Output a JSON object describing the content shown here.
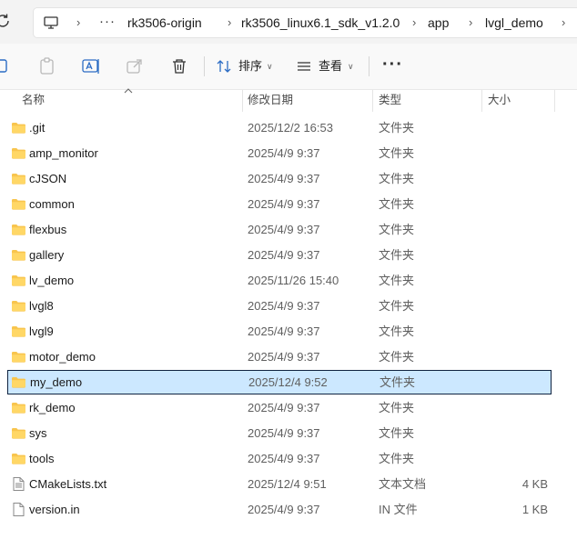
{
  "breadcrumb": {
    "overflow": "···",
    "items": [
      "rk3506-origin",
      "rk3506_linux6.1_sdk_v1.2.0",
      "app",
      "lvgl_demo"
    ]
  },
  "toolbar": {
    "sort_label": "排序",
    "view_label": "查看",
    "more_label": "···"
  },
  "columns": {
    "name": "名称",
    "date": "修改日期",
    "type": "类型",
    "size": "大小"
  },
  "files": [
    {
      "name": ".git",
      "date": "2025/12/2 16:53",
      "type": "文件夹",
      "size": "",
      "icon": "folder-icon"
    },
    {
      "name": "amp_monitor",
      "date": "2025/4/9 9:37",
      "type": "文件夹",
      "size": "",
      "icon": "folder-icon"
    },
    {
      "name": "cJSON",
      "date": "2025/4/9 9:37",
      "type": "文件夹",
      "size": "",
      "icon": "folder-icon"
    },
    {
      "name": "common",
      "date": "2025/4/9 9:37",
      "type": "文件夹",
      "size": "",
      "icon": "folder-icon"
    },
    {
      "name": "flexbus",
      "date": "2025/4/9 9:37",
      "type": "文件夹",
      "size": "",
      "icon": "folder-icon"
    },
    {
      "name": "gallery",
      "date": "2025/4/9 9:37",
      "type": "文件夹",
      "size": "",
      "icon": "folder-icon"
    },
    {
      "name": "lv_demo",
      "date": "2025/11/26 15:40",
      "type": "文件夹",
      "size": "",
      "icon": "folder-icon"
    },
    {
      "name": "lvgl8",
      "date": "2025/4/9 9:37",
      "type": "文件夹",
      "size": "",
      "icon": "folder-icon"
    },
    {
      "name": "lvgl9",
      "date": "2025/4/9 9:37",
      "type": "文件夹",
      "size": "",
      "icon": "folder-icon"
    },
    {
      "name": "motor_demo",
      "date": "2025/4/9 9:37",
      "type": "文件夹",
      "size": "",
      "icon": "folder-icon"
    },
    {
      "name": "my_demo",
      "date": "2025/12/4 9:52",
      "type": "文件夹",
      "size": "",
      "icon": "folder-icon",
      "selected": true
    },
    {
      "name": "rk_demo",
      "date": "2025/4/9 9:37",
      "type": "文件夹",
      "size": "",
      "icon": "folder-icon"
    },
    {
      "name": "sys",
      "date": "2025/4/9 9:37",
      "type": "文件夹",
      "size": "",
      "icon": "folder-icon"
    },
    {
      "name": "tools",
      "date": "2025/4/9 9:37",
      "type": "文件夹",
      "size": "",
      "icon": "folder-icon"
    },
    {
      "name": "CMakeLists.txt",
      "date": "2025/12/4 9:51",
      "type": "文本文档",
      "size": "4 KB",
      "icon": "text-file-icon"
    },
    {
      "name": "version.in",
      "date": "2025/4/9 9:37",
      "type": "IN 文件",
      "size": "1 KB",
      "icon": "file-icon"
    }
  ],
  "colors": {
    "selection_bg": "#cce8ff",
    "selection_border": "#0f2340",
    "folder_yellow": "#f8c54e",
    "accent_blue": "#2b6cc4"
  }
}
